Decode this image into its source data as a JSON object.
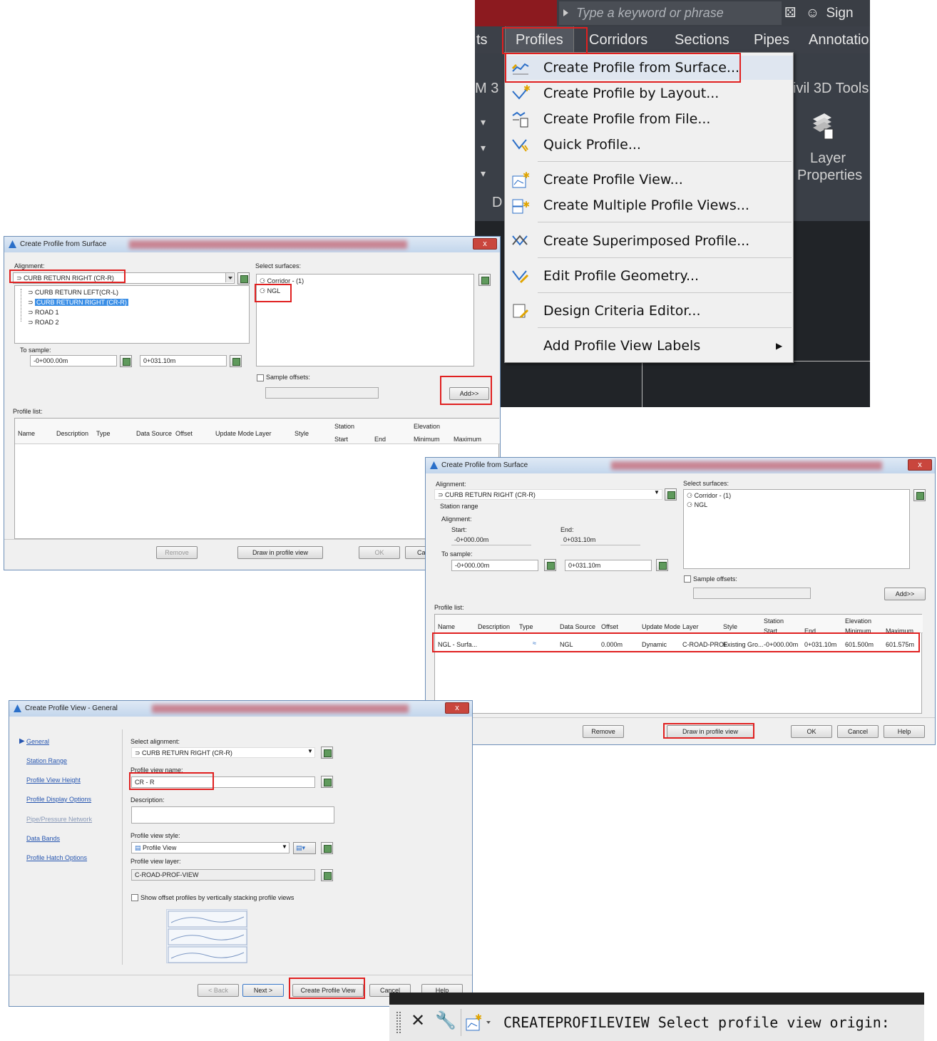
{
  "menu_screenshot": {
    "search_placeholder": "Type a keyword or phrase",
    "sign_label": "Sign",
    "ribbon_tabs": [
      "ts",
      "Profiles",
      "Corridors",
      "Sections",
      "Pipes",
      "Annotatio"
    ],
    "left_fragments": [
      "M 3",
      "D"
    ],
    "right_panel_label": "ivil 3D Tools",
    "layer_properties": [
      "Layer",
      "Properties"
    ],
    "dropdown_items": [
      {
        "label": "Create Profile from Surface...",
        "icon": "profile-from-surface-icon"
      },
      {
        "label": "Create Profile by Layout...",
        "icon": "profile-layout-icon"
      },
      {
        "label": "Create Profile from File...",
        "icon": "profile-file-icon"
      },
      {
        "label": "Quick Profile...",
        "icon": "quick-profile-icon"
      },
      {
        "label": "Create Profile View...",
        "icon": "profile-view-icon"
      },
      {
        "label": "Create Multiple Profile Views...",
        "icon": "multiple-profile-views-icon"
      },
      {
        "label": "Create Superimposed Profile...",
        "icon": "superimposed-profile-icon"
      },
      {
        "label": "Edit Profile Geometry...",
        "icon": "edit-profile-geometry-icon"
      },
      {
        "label": "Design Criteria Editor...",
        "icon": "design-criteria-icon"
      },
      {
        "label": "Add Profile View Labels",
        "icon": ""
      }
    ]
  },
  "dialog1": {
    "title": "Create Profile from Surface",
    "close": "x",
    "alignment_label": "Alignment:",
    "alignment_value": "CURB RETURN RIGHT (CR-R)",
    "tree_items": [
      "CURB RETURN LEFT(CR-L)",
      "CURB RETURN RIGHT (CR-R)",
      "ROAD 1",
      "ROAD 2"
    ],
    "surfaces_label": "Select surfaces:",
    "surfaces": [
      "Corridor - (1)",
      "NGL"
    ],
    "to_sample_label": "To sample:",
    "sample_start": "-0+000.00m",
    "sample_end": "0+031.10m",
    "sample_offsets_label": "Sample offsets:",
    "add_button": "Add>>",
    "profile_list_label": "Profile list:",
    "columns": [
      "Name",
      "Description",
      "Type",
      "Data Source",
      "Offset",
      "Update Mode",
      "Layer",
      "Style"
    ],
    "station_header": "Station",
    "elevation_header": "Elevation",
    "sub_columns": [
      "Start",
      "End",
      "Minimum",
      "Maximum"
    ],
    "buttons": [
      "Remove",
      "Draw in profile view",
      "OK",
      "Ca"
    ]
  },
  "dialog2": {
    "title": "Create Profile from Surface",
    "close": "x",
    "alignment_label": "Alignment:",
    "alignment_value": "CURB RETURN RIGHT (CR-R)",
    "station_range_label": "Station range",
    "alignment_sub": "Alignment:",
    "start_label": "Start:",
    "end_label": "End:",
    "align_start": "-0+000.00m",
    "align_end": "0+031.10m",
    "to_sample_label": "To sample:",
    "sample_start": "-0+000.00m",
    "sample_end": "0+031.10m",
    "surfaces_label": "Select surfaces:",
    "surfaces": [
      "Corridor - (1)",
      "NGL"
    ],
    "sample_offsets_label": "Sample offsets:",
    "add_button": "Add>>",
    "profile_list_label": "Profile list:",
    "columns": [
      "Name",
      "Description",
      "Type",
      "Data Source",
      "Offset",
      "Update Mode",
      "Layer",
      "Style"
    ],
    "station_header": "Station",
    "elevation_header": "Elevation",
    "sub_columns": [
      "Start",
      "End",
      "Minimum",
      "Maximum"
    ],
    "row": {
      "name": "NGL - Surfa...",
      "data_source": "NGL",
      "offset": "0.000m",
      "update_mode": "Dynamic",
      "layer": "C-ROAD-PROF",
      "style": "Existing Gro...",
      "start": "-0+000.00m",
      "end": "0+031.10m",
      "minimum": "601.500m",
      "maximum": "601.575m"
    },
    "buttons": [
      "Remove",
      "Draw in profile view",
      "OK",
      "Cancel",
      "Help"
    ]
  },
  "dialog3": {
    "title": "Create Profile View - General",
    "close": "x",
    "nav": [
      "General",
      "Station Range",
      "Profile View Height",
      "Profile Display Options",
      "Pipe/Pressure Network",
      "Data Bands",
      "Profile Hatch Options"
    ],
    "select_alignment_label": "Select alignment:",
    "alignment_value": "CURB RETURN RIGHT (CR-R)",
    "view_name_label": "Profile view name:",
    "view_name_value": "CR - R",
    "description_label": "Description:",
    "style_label": "Profile view style:",
    "style_value": "Profile View",
    "layer_label": "Profile view layer:",
    "layer_value": "C-ROAD-PROF-VIEW",
    "stack_label": "Show offset profiles by vertically stacking profile views",
    "buttons": [
      "< Back",
      "Next >",
      "Create Profile View",
      "Cancel",
      "Help"
    ]
  },
  "command_line": {
    "text": "CREATEPROFILEVIEW Select profile view origin:"
  },
  "colors": {
    "highlight": "#e02020",
    "selection": "#3a8ee6",
    "dark_ui": "#2b2f36"
  }
}
